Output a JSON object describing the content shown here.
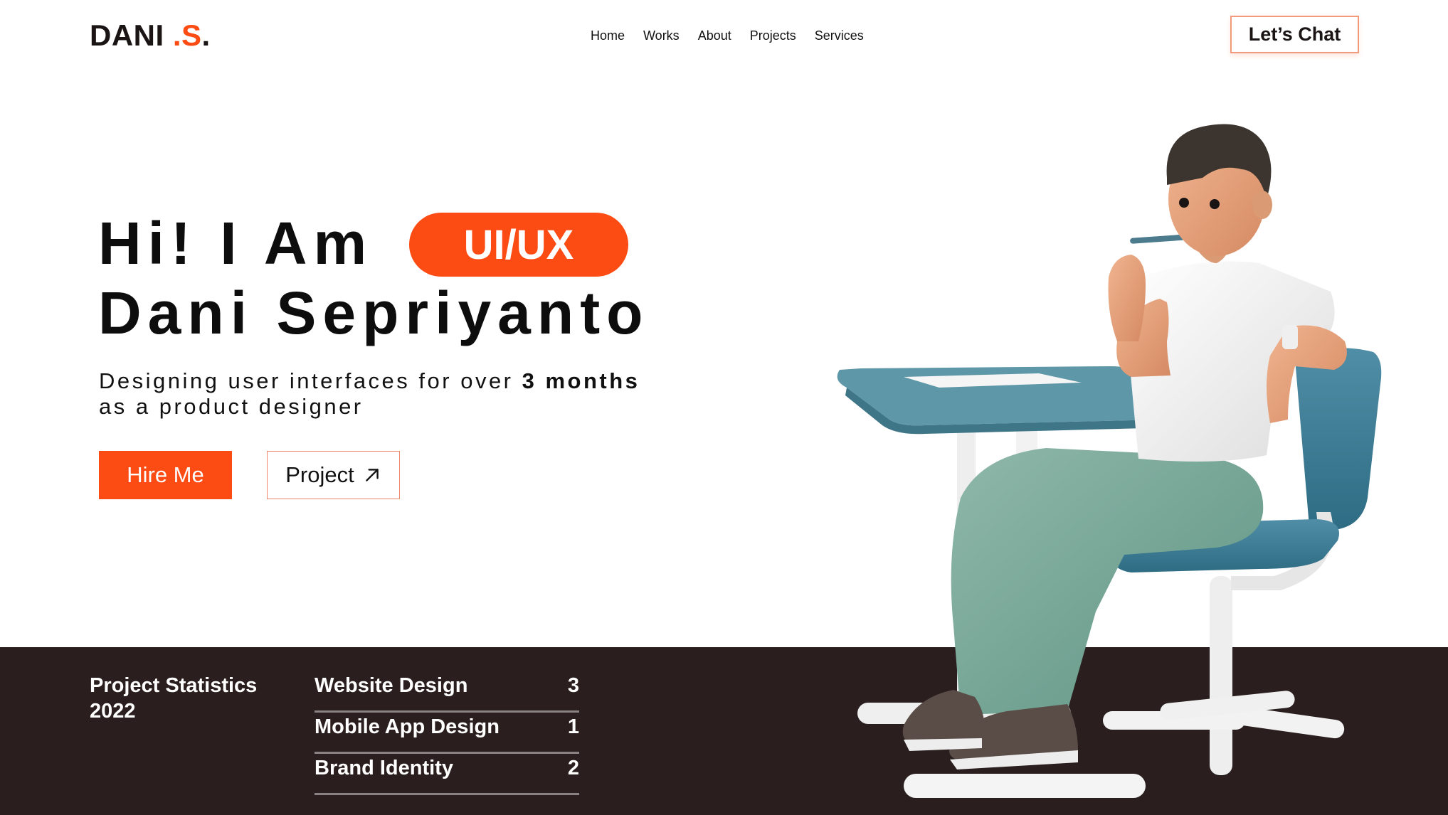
{
  "header": {
    "logo_main": "DANI ",
    "logo_accent": ".S",
    "logo_dot": ".",
    "nav": [
      "Home",
      "Works",
      "About",
      "Projects",
      "Services"
    ],
    "cta_label": "Let’s Chat"
  },
  "hero": {
    "greeting": "Hi! I Am",
    "role_pill": "UI/UX",
    "name": "Dani Sepriyanto",
    "subtitle_start": "Designing user interfaces for over ",
    "subtitle_bold": "3 months",
    "subtitle_end": "as a product designer",
    "hire_label": "Hire Me",
    "project_label": "Project"
  },
  "stats": {
    "title": "Project Statistics 2022",
    "items": [
      {
        "label": "Website Design",
        "count": "3"
      },
      {
        "label": "Mobile App Design",
        "count": "1"
      },
      {
        "label": "Brand Identity",
        "count": "2"
      }
    ]
  },
  "colors": {
    "accent": "#fc4c13",
    "band": "#2a1e1e",
    "text": "#0d0d0d"
  },
  "icons": {
    "project_arrow": "arrow-up-right-icon",
    "illustration": "man-at-desk-illustration"
  }
}
